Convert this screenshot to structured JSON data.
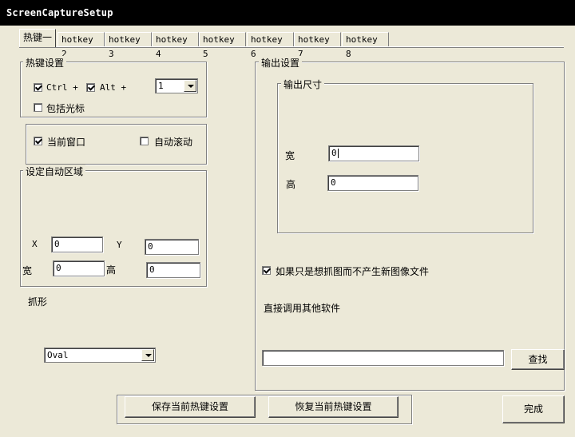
{
  "window": {
    "title": "ScreenCaptureSetup"
  },
  "tabs": [
    "热键一",
    "hotkey 2",
    "hotkey 3",
    "hotkey 4",
    "hotkey 5",
    "hotkey 6",
    "hotkey 7",
    "hotkey 8"
  ],
  "hotkey_group": {
    "label": "热键设置",
    "ctrl": {
      "label": "Ctrl +",
      "checked": true
    },
    "alt": {
      "label": "Alt +",
      "checked": true
    },
    "key_value": "1",
    "include_cursor": {
      "label": "包括光标",
      "checked": false
    }
  },
  "window_group": {
    "current_window": {
      "label": "当前窗口",
      "checked": true
    },
    "auto_scroll": {
      "label": "自动滚动",
      "checked": false
    }
  },
  "auto_region": {
    "label": "设定自动区域",
    "x_label": "X",
    "x_value": "0",
    "y_label": "Y",
    "y_value": "0",
    "w_label": "宽",
    "w_value": "0",
    "h_label": "高",
    "h_value": "0"
  },
  "shape": {
    "label": "抓形",
    "value": "Oval"
  },
  "output": {
    "label": "输出设置",
    "size_label": "输出尺寸",
    "width_label": "宽",
    "width_value": "0",
    "height_label": "高",
    "height_value": "0",
    "grab_only": {
      "label": "如果只是想抓图而不产生新图像文件",
      "checked": true
    },
    "call_other_label": "直接调用其他软件",
    "path_value": "",
    "browse_label": "查找"
  },
  "footer": {
    "save_label": "保存当前热键设置",
    "restore_label": "恢复当前热键设置",
    "done_label": "完成"
  }
}
